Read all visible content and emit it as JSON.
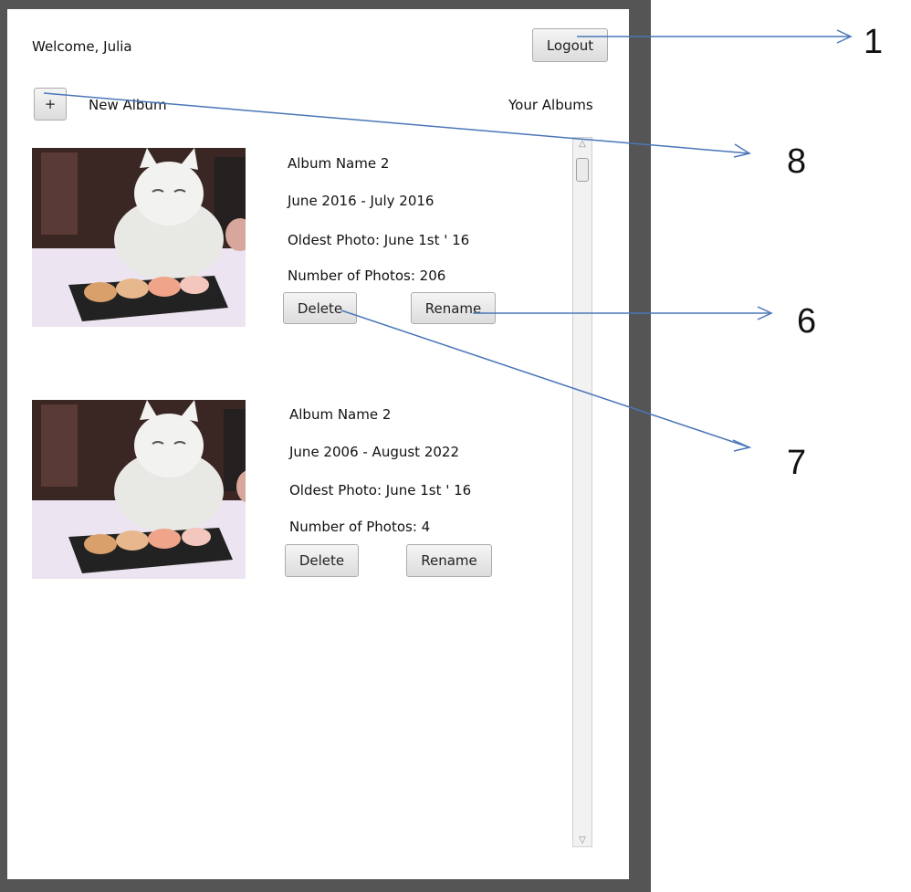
{
  "header": {
    "welcome_text": "Welcome, Julia",
    "logout_label": "Logout",
    "add_label": "+",
    "new_album_label": "New Album",
    "your_albums_label": "Your Albums"
  },
  "albums": [
    {
      "name": "Album Name 2",
      "date_range": "June 2016 - July 2016",
      "oldest": "Oldest Photo: June 1st ' 16",
      "count": "Number of Photos: 206",
      "delete_label": "Delete",
      "rename_label": "Rename"
    },
    {
      "name": "Album Name 2",
      "date_range": "June 2006 - August 2022",
      "oldest": "Oldest Photo: June 1st ' 16",
      "count": "Number of Photos: 4",
      "delete_label": "Delete",
      "rename_label": "Rename"
    }
  ],
  "callouts": {
    "logout": "1",
    "new_album": "8",
    "rename": "6",
    "delete": "7"
  },
  "colors": {
    "arrow": "#4a76b8",
    "frame": "#555555"
  }
}
